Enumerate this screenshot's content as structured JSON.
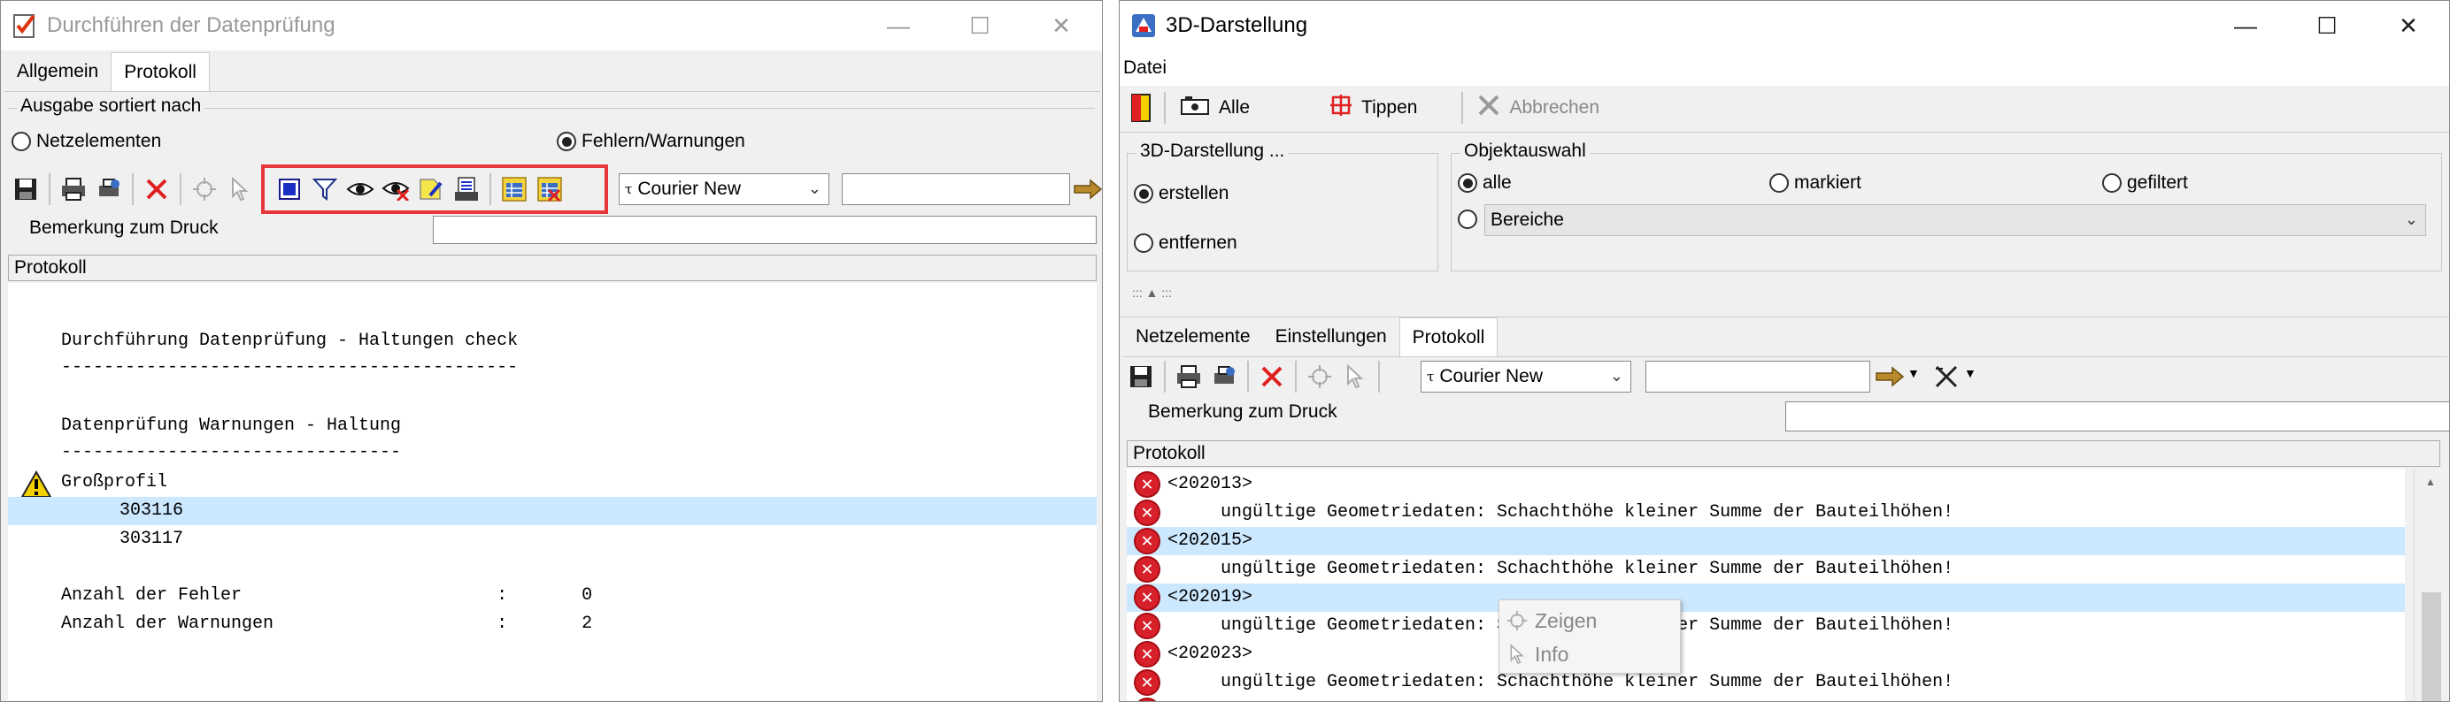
{
  "left_window": {
    "title": "Durchführen der Datenprüfung",
    "tabs": [
      "Allgemein",
      "Protokoll"
    ],
    "sort_group": {
      "legend": "Ausgabe sortiert nach",
      "option_elements": "Netzelementen",
      "option_errors": "Fehlern/Warnungen"
    },
    "font_combo": "Courier New",
    "remark_label": "Bemerkung zum Druck",
    "protocol_header": "Protokoll",
    "protocol_lines": [
      "Durchführung Datenprüfung - Haltungen check",
      "-------------------------------------------",
      "Datenprüfung Warnungen - Haltung",
      "--------------------------------",
      "Großprofil",
      "303116",
      "303117",
      "Anzahl der Fehler                        :       0",
      "Anzahl der Warnungen                     :       2"
    ]
  },
  "right_window": {
    "title": "3D-Darstellung",
    "menu": [
      "Datei"
    ],
    "toolbar": {
      "all": "Alle",
      "tip": "Tippen",
      "cancel": "Abbrechen"
    },
    "group_3d": {
      "legend": "3D-Darstellung ...",
      "create": "erstellen",
      "remove": "entfernen"
    },
    "group_obj": {
      "legend": "Objektauswahl",
      "all": "alle",
      "marked": "markiert",
      "filtered": "gefiltert",
      "areas": "Bereiche"
    },
    "tabs": [
      "Netzelemente",
      "Einstellungen",
      "Protokoll"
    ],
    "font_combo": "Courier New",
    "remark_label": "Bemerkung zum Druck",
    "protocol_header": "Protokoll",
    "protocol_lines": [
      "<202013>",
      "ungültige Geometriedaten: Schachthöhe kleiner Summe der Bauteilhöhen!",
      "<202015>",
      "ungültige Geometriedaten: Schachthöhe kleiner Summe der Bauteilhöhen!",
      "<202019>",
      "ungültige Geometriedaten: Schachthöhe kleiner Summe der Bauteilhöhen!",
      "<202023>",
      "ungültige Geometriedaten: Schachthöhe kleiner Summe der Bauteilhöhen!"
    ],
    "context_menu": {
      "show": "Zeigen",
      "info": "Info"
    }
  },
  "colors": {
    "highlight": "#cce8ff",
    "red_frame": "#e8373a",
    "error_red": "#d8202a"
  }
}
